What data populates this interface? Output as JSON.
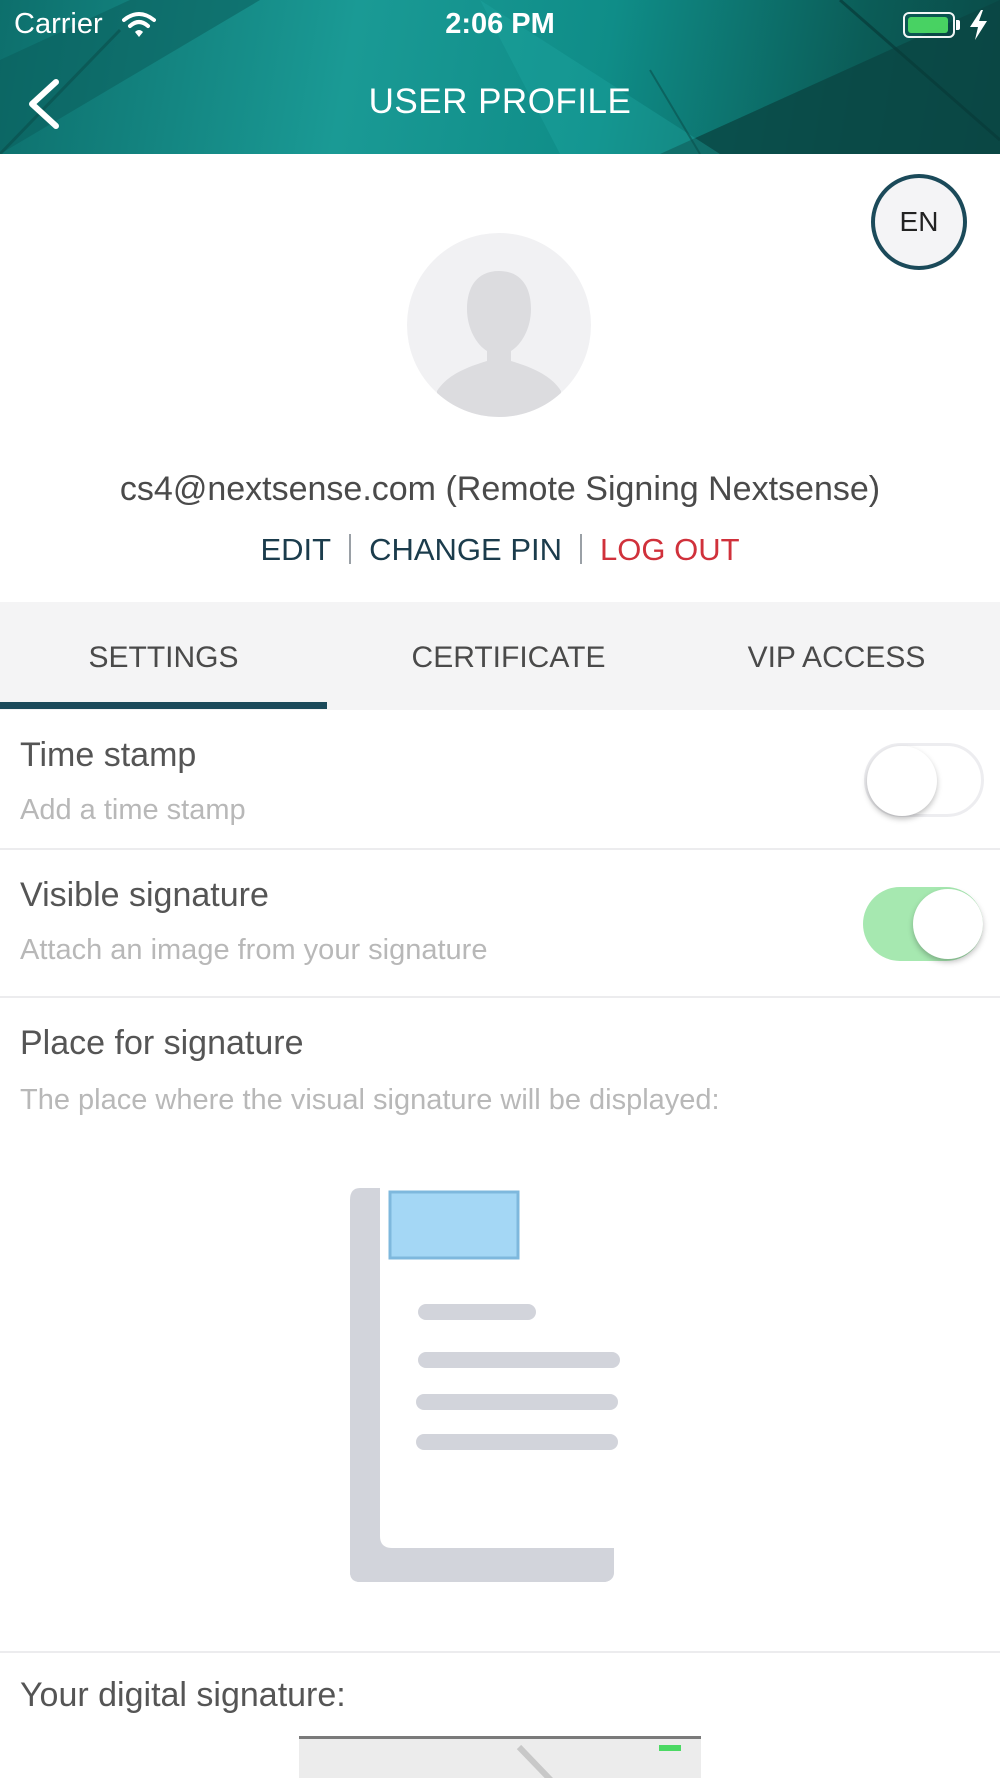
{
  "status_bar": {
    "carrier": "Carrier",
    "time": "2:06 PM"
  },
  "header": {
    "title": "USER PROFILE",
    "gradient_colors": [
      "#0d6f6c",
      "#1a9a95",
      "#0a4a47"
    ]
  },
  "language": {
    "code": "EN"
  },
  "user": {
    "display": "cs4@nextsense.com (Remote Signing Nextsense)",
    "actions": {
      "edit": "EDIT",
      "change_pin": "CHANGE PIN",
      "logout": "LOG OUT"
    }
  },
  "tabs": [
    {
      "label": "SETTINGS",
      "active": true
    },
    {
      "label": "CERTIFICATE",
      "active": false
    },
    {
      "label": "VIP ACCESS",
      "active": false
    }
  ],
  "settings": {
    "timestamp": {
      "title": "Time stamp",
      "subtitle": "Add a time stamp",
      "enabled": false
    },
    "visible_signature": {
      "title": "Visible signature",
      "subtitle": "Attach an image from your signature",
      "enabled": true
    },
    "placement": {
      "title": "Place for signature",
      "subtitle": "The place where the visual signature will be displayed:",
      "position": "top-left"
    },
    "digital_signature": {
      "title": "Your digital signature:"
    }
  },
  "colors": {
    "accent": "#1b4a5a",
    "logout": "#d0313b",
    "toggle_on": "#a6e8b0",
    "signature_box": "#a4d7f5"
  }
}
